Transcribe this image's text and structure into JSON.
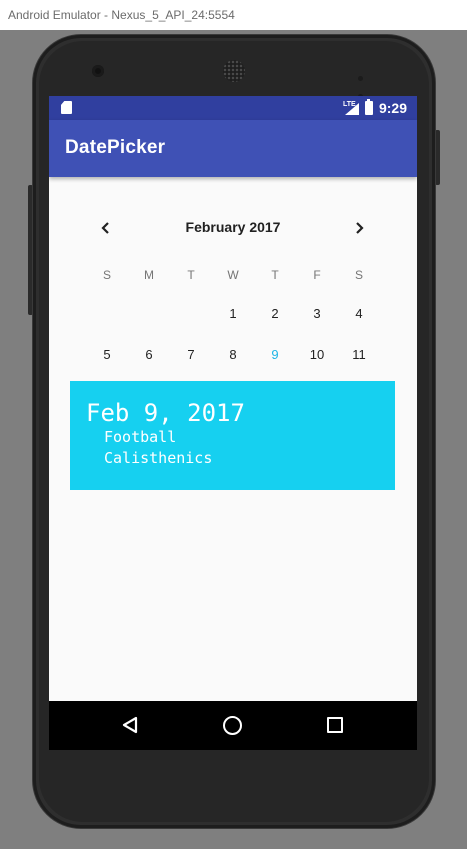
{
  "window": {
    "title": "Android Emulator - Nexus_5_API_24:5554"
  },
  "status_bar": {
    "network": "LTE",
    "time": "9:29"
  },
  "app_bar": {
    "title": "DatePicker"
  },
  "calendar": {
    "month_label": "February 2017",
    "weekdays": [
      "S",
      "M",
      "T",
      "W",
      "T",
      "F",
      "S"
    ],
    "weeks": [
      [
        "",
        "",
        "",
        "1",
        "2",
        "3",
        "4"
      ],
      [
        "5",
        "6",
        "7",
        "8",
        "9",
        "10",
        "11"
      ]
    ],
    "selected_day": "9",
    "selected_color": "#1eb6e6"
  },
  "event_card": {
    "date": "Feb 9, 2017",
    "items": [
      "Football",
      "Calisthenics"
    ],
    "background": "#16d0f0"
  },
  "nav_bar": {
    "back_icon": "back-triangle-icon",
    "home_icon": "home-circle-icon",
    "recents_icon": "recents-square-icon"
  },
  "colors": {
    "primary": "#3f51b5",
    "primary_dark": "#303f9f"
  }
}
